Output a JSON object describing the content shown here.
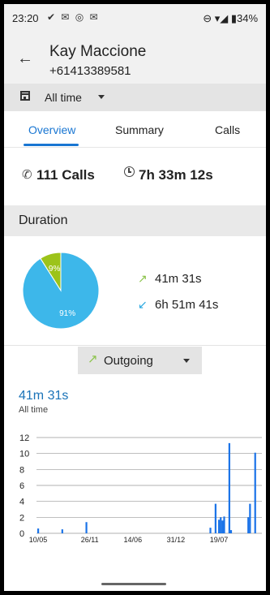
{
  "status_bar": {
    "time": "23:20",
    "left_icons": "✔ ✉ ◎ ✉",
    "right": "⊖ ▾◢ ▮34%"
  },
  "header": {
    "back_icon": "←",
    "contact_name": "Kay Maccione",
    "phone": "+61413389581"
  },
  "filter": {
    "period": "All time"
  },
  "tabs": [
    {
      "label": "Overview",
      "active": true
    },
    {
      "label": "Summary",
      "active": false
    },
    {
      "label": "Calls",
      "active": false
    }
  ],
  "stats": {
    "calls_icon": "✆",
    "calls": "111 Calls",
    "duration": "7h 33m 12s"
  },
  "duration": {
    "title": "Duration",
    "outgoing_arrow": "↗",
    "incoming_arrow": "↙",
    "outgoing": "41m 31s",
    "incoming": "6h 51m 41s",
    "pie": {
      "slices": [
        {
          "label": "9%",
          "value": 9,
          "color": "#9cc31a"
        },
        {
          "label": "91%",
          "value": 91,
          "color": "#3db7ea"
        }
      ]
    }
  },
  "direction": {
    "arrow": "↗",
    "label": "Outgoing"
  },
  "total": {
    "value": "41m 31s",
    "subtitle": "All time"
  },
  "chart_data": {
    "type": "bar",
    "title": "",
    "ylim": [
      0,
      12
    ],
    "yticks": [
      "0",
      "2",
      "4",
      "6",
      "8",
      "10",
      "12"
    ],
    "xticks": [
      "10/05",
      "26/11",
      "14/06",
      "31/12",
      "19/07"
    ],
    "xtick_index": [
      0,
      30,
      55,
      80,
      105
    ],
    "n_points": 130,
    "color": "#1a73e8",
    "bars": [
      {
        "i": 0,
        "v": 0.6
      },
      {
        "i": 14,
        "v": 0.5
      },
      {
        "i": 28,
        "v": 1.4
      },
      {
        "i": 100,
        "v": 0.7
      },
      {
        "i": 103,
        "v": 3.7
      },
      {
        "i": 105,
        "v": 1.7
      },
      {
        "i": 106,
        "v": 2.0
      },
      {
        "i": 107,
        "v": 1.6
      },
      {
        "i": 108,
        "v": 2.1
      },
      {
        "i": 111,
        "v": 11.3
      },
      {
        "i": 112,
        "v": 0.4
      },
      {
        "i": 122,
        "v": 2.0
      },
      {
        "i": 123,
        "v": 3.7
      },
      {
        "i": 126,
        "v": 10.1
      }
    ]
  }
}
